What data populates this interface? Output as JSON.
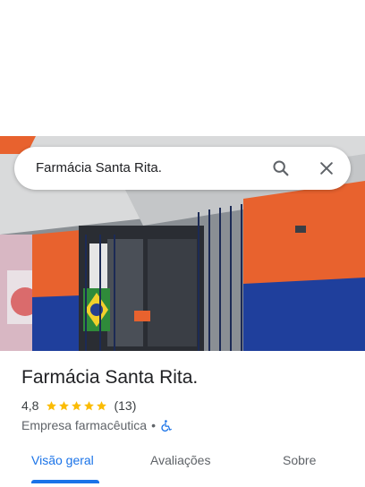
{
  "search": {
    "query": "Farmácia Santa Rita."
  },
  "place": {
    "name": "Farmácia Santa Rita.",
    "rating": "4,8",
    "rating_value": 4.8,
    "review_count": "(13)",
    "category": "Empresa farmacêutica",
    "separator": "•",
    "star_color": "#fbbc04"
  },
  "tabs": [
    {
      "label": "Visão geral",
      "active": true
    },
    {
      "label": "Avaliações",
      "active": false
    },
    {
      "label": "Sobre",
      "active": false
    }
  ],
  "colors": {
    "accent": "#1a73e8",
    "wall_orange": "#e8622e",
    "wall_blue": "#1f3f9c"
  },
  "icons": {
    "search": "search-icon",
    "close": "close-icon",
    "accessibility": "wheelchair-icon"
  }
}
